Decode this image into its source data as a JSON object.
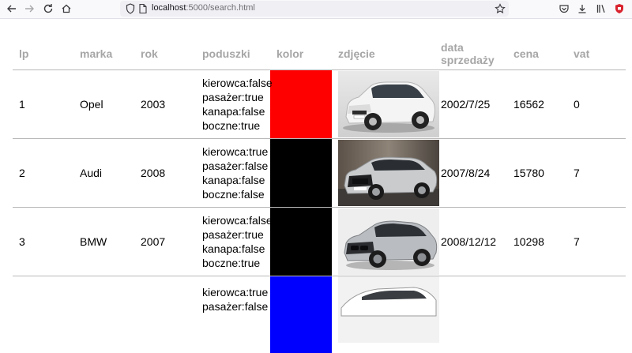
{
  "browser": {
    "url_host": "localhost",
    "url_rest": ":5000/search.html"
  },
  "table": {
    "headers": [
      "lp",
      "marka",
      "rok",
      "poduszki",
      "kolor",
      "zdjęcie",
      "data sprzedaży",
      "cena",
      "vat"
    ],
    "rows": [
      {
        "lp": "1",
        "marka": "Opel",
        "rok": "2003",
        "bags": [
          "kierowca:false",
          "pasażer:true",
          "kanapa:false",
          "boczne:true"
        ],
        "color": "#ff0000",
        "date": "2002/7/25",
        "price": "16562",
        "vat": "0"
      },
      {
        "lp": "2",
        "marka": "Audi",
        "rok": "2008",
        "bags": [
          "kierowca:true",
          "pasażer:false",
          "kanapa:false",
          "boczne:false"
        ],
        "color": "#000000",
        "date": "2007/8/24",
        "price": "15780",
        "vat": "7"
      },
      {
        "lp": "3",
        "marka": "BMW",
        "rok": "2007",
        "bags": [
          "kierowca:false",
          "pasażer:true",
          "kanapa:false",
          "boczne:true"
        ],
        "color": "#000000",
        "date": "2008/12/12",
        "price": "10298",
        "vat": "7"
      },
      {
        "lp": "",
        "marka": "",
        "rok": "",
        "bags": [
          "kierowca:true",
          "pasażer:false"
        ],
        "color": "#0000ff",
        "date": "",
        "price": "",
        "vat": ""
      }
    ]
  }
}
